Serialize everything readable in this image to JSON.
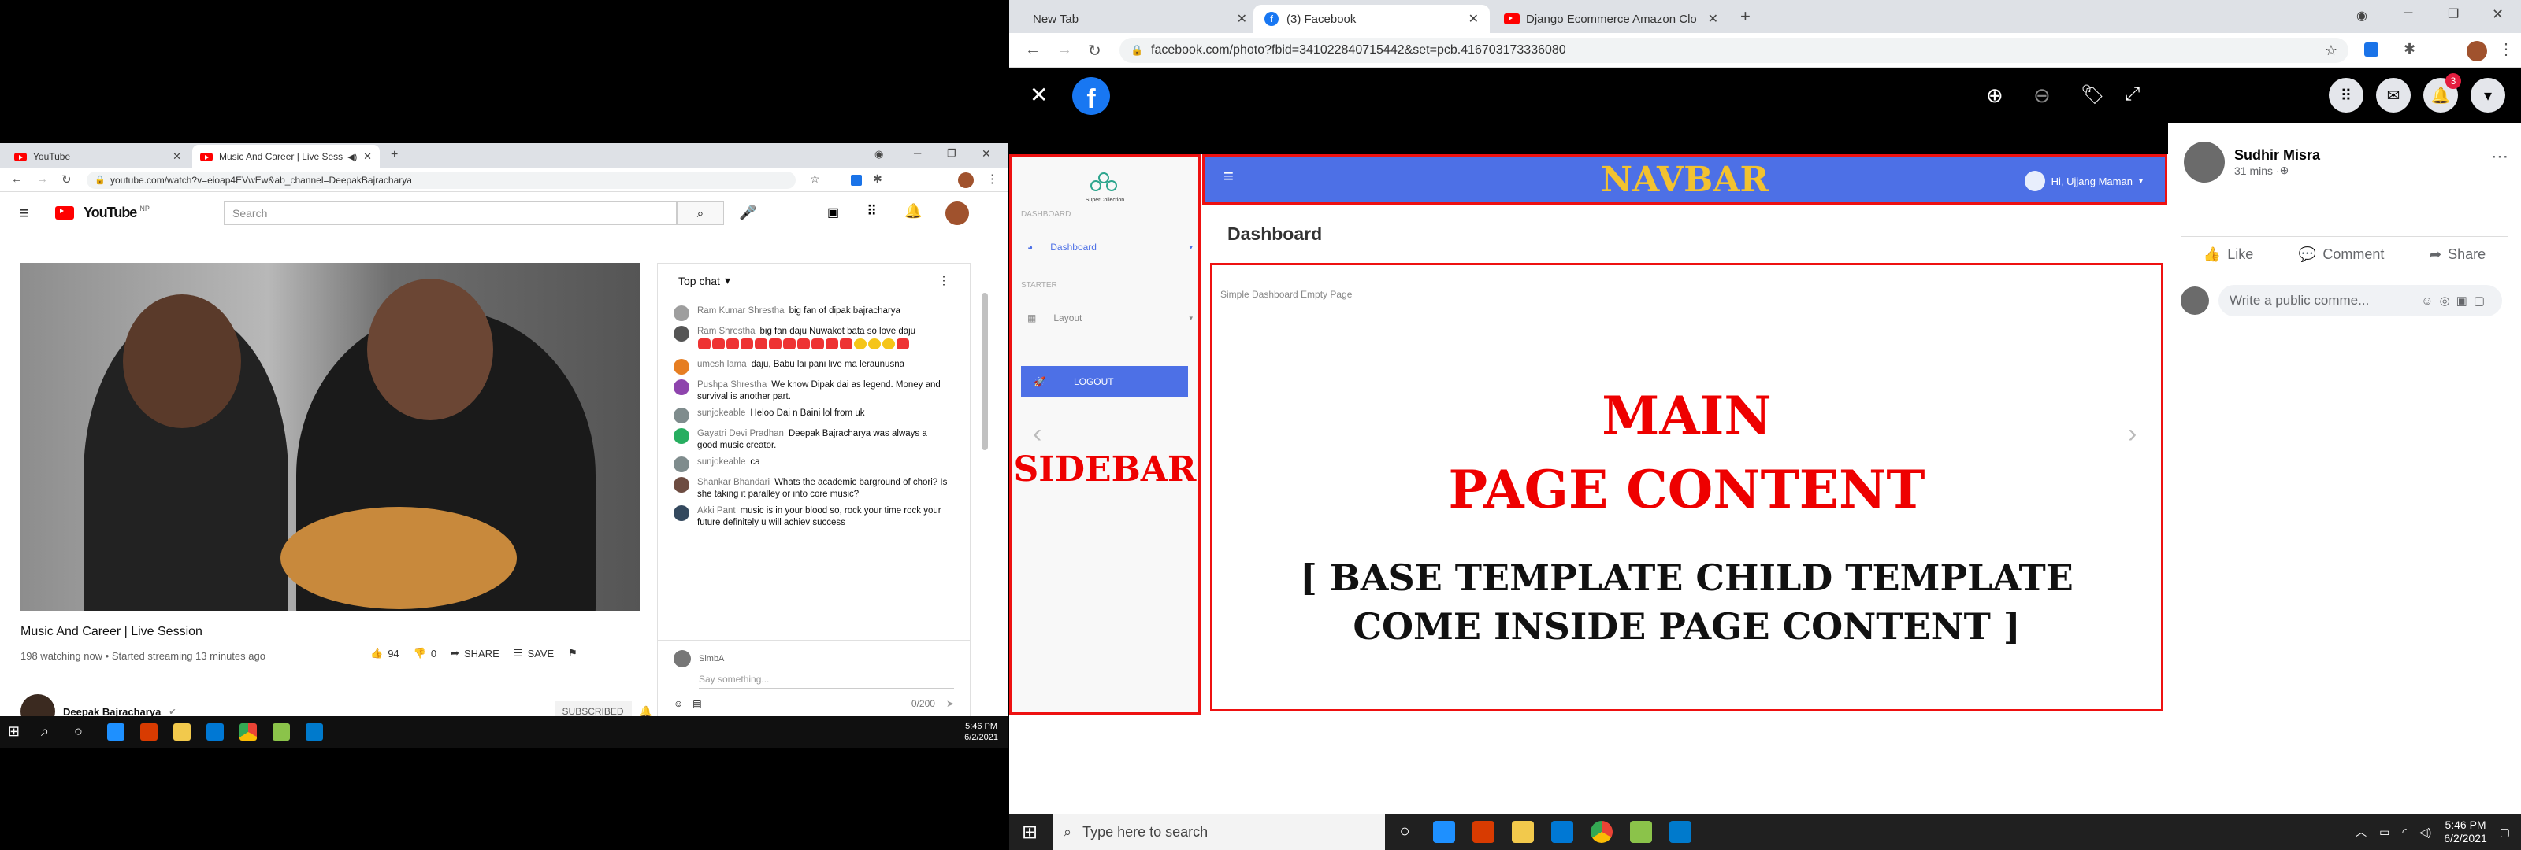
{
  "left_browser": {
    "tabs": [
      {
        "label": "YouTube"
      },
      {
        "label": "Music And Career | Live Sess"
      }
    ],
    "url": "youtube.com/watch?v=eioap4EVwEw&ab_channel=DeepakBajracharya",
    "search_placeholder": "Search",
    "logo_text": "YouTube",
    "logo_region": "NP",
    "video_title": "Music And Career | Live Session",
    "video_meta": "198 watching now • Started streaming 13 minutes ago",
    "likes": "94",
    "dislikes": "0",
    "share_label": "SHARE",
    "save_label": "SAVE",
    "channel_name": "Deepak Bajracharya",
    "subscribed_label": "SUBSCRIBED",
    "chat": {
      "title": "Top chat",
      "messages": [
        {
          "author": "Ram Kumar Shrestha",
          "text": "big fan of dipak bajracharya",
          "color": "#9e9e9e"
        },
        {
          "author": "Ram Shrestha",
          "text": "big fan daju Nuwakot bata so love daju",
          "color": "#555555"
        },
        {
          "author": "umesh lama",
          "text": "daju, Babu lai pani live ma leraunusna",
          "color": "#e67e22"
        },
        {
          "author": "Pushpa Shrestha",
          "text": "We know Dipak dai as legend. Money and survival is another part.",
          "color": "#8e44ad"
        },
        {
          "author": "sunjokeable",
          "text": "Heloo Dai n Baini lol from uk",
          "color": "#7f8c8d"
        },
        {
          "author": "Gayatri Devi Pradhan",
          "text": "Deepak Bajracharya was always a good music creator.",
          "color": "#27ae60"
        },
        {
          "author": "sunjokeable",
          "text": "ca",
          "color": "#7f8c8d"
        },
        {
          "author": "Shankar Bhandari",
          "text": "Whats the academic barground of chori? Is she taking it paralley or into core music?",
          "color": "#6d4c41"
        },
        {
          "author": "Akki Pant",
          "text": "music is in your blood so, rock your time rock your future definitely u will achiev success",
          "color": "#34495e"
        }
      ],
      "input_user": "SimbA",
      "input_placeholder": "Say something...",
      "char_count": "0/200"
    },
    "taskbar_time": "5:46 PM",
    "taskbar_date": "6/2/2021"
  },
  "right_browser": {
    "tabs": [
      {
        "label": "New Tab"
      },
      {
        "label": "(3) Facebook"
      },
      {
        "label": "Django Ecommerce Amazon Clo"
      }
    ],
    "url": "facebook.com/photo?fbid=341022840715442&set=pcb.416703173336080",
    "photo": {
      "sidebar_brand": "SuperCollection",
      "sidebar_section1": "DASHBOARD",
      "sidebar_item_dashboard": "Dashboard",
      "sidebar_section2": "STARTER",
      "sidebar_item_layout": "Layout",
      "logout_label": "LOGOUT",
      "sidebar_label": "SIDEBAR",
      "navbar_label": "NAVBAR",
      "user_greeting": "Hi, Ujjang Maman",
      "page_heading": "Dashboard",
      "empty_page_note": "Simple Dashboard Empty Page",
      "main_line1": "MAIN",
      "main_line2": "PAGE CONTENT",
      "bracket_line1": "[ BASE TEMPLATE CHILD TEMPLATE",
      "bracket_line2": "COME INSIDE PAGE CONTENT ]"
    },
    "post_author": "Sudhir Misra",
    "post_time": "31 mins · ",
    "like_label": "Like",
    "comment_label": "Comment",
    "share_label": "Share",
    "comment_placeholder": "Write a public comme...",
    "notification_count": "3"
  },
  "taskbar": {
    "search_placeholder": "Type here to search",
    "time": "5:46 PM",
    "date": "6/2/2021"
  },
  "colors": {
    "youtube_red": "#ff0000",
    "facebook_blue": "#1877f2",
    "navbar_blue": "#4d70e6",
    "annotation_red": "#e11111"
  }
}
